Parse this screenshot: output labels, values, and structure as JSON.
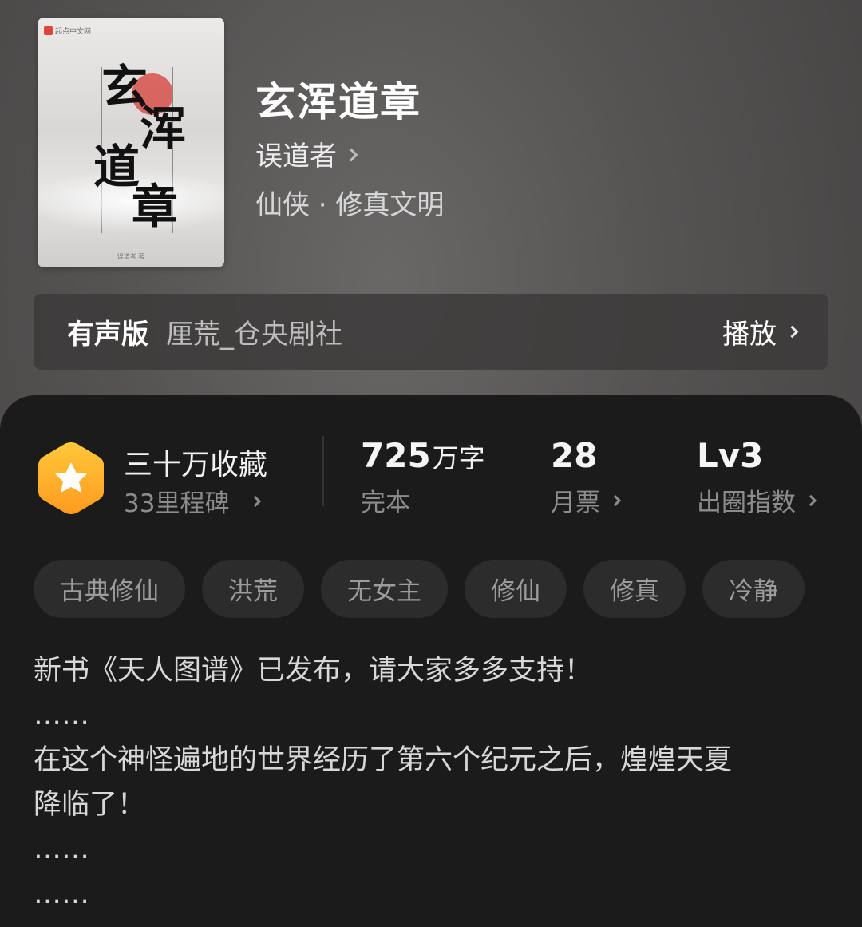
{
  "book": {
    "title": "玄浑道章",
    "author": "误道者",
    "genre": "仙侠 · 修真文明",
    "cover": {
      "publisher": "起点中文网",
      "calligraphy": [
        "玄",
        "浑",
        "道",
        "章"
      ],
      "author_small": "误道者 著"
    }
  },
  "audio": {
    "label": "有声版",
    "narrator": "厘荒_仓央剧社",
    "play_label": "播放"
  },
  "stats": {
    "favorites": {
      "title": "三十万收藏",
      "sub": "33里程碑"
    },
    "words": {
      "value": "725",
      "unit": "万字",
      "label": "完本"
    },
    "monthly_votes": {
      "value": "28",
      "label": "月票"
    },
    "influence": {
      "value": "Lv3",
      "label": "出圈指数"
    }
  },
  "tags": [
    "古典修仙",
    "洪荒",
    "无女主",
    "修仙",
    "修真",
    "冷静"
  ],
  "description": {
    "line1": "新书《天人图谱》已发布，请大家多多支持！",
    "line2": "……",
    "line3": "在这个神怪遍地的世界经历了第六个纪元之后，煌煌天夏",
    "line4": "降临了！",
    "line5": "……",
    "line6": "……"
  },
  "colors": {
    "badge_gradient_top": "#ffc83a",
    "badge_gradient_bottom": "#ff9a1f",
    "panel_bg": "#1b1b1b",
    "tag_bg": "#2c2c2c"
  },
  "icons": {
    "badge": "star-hexagon-icon",
    "chevron": "chevron-right-icon"
  }
}
